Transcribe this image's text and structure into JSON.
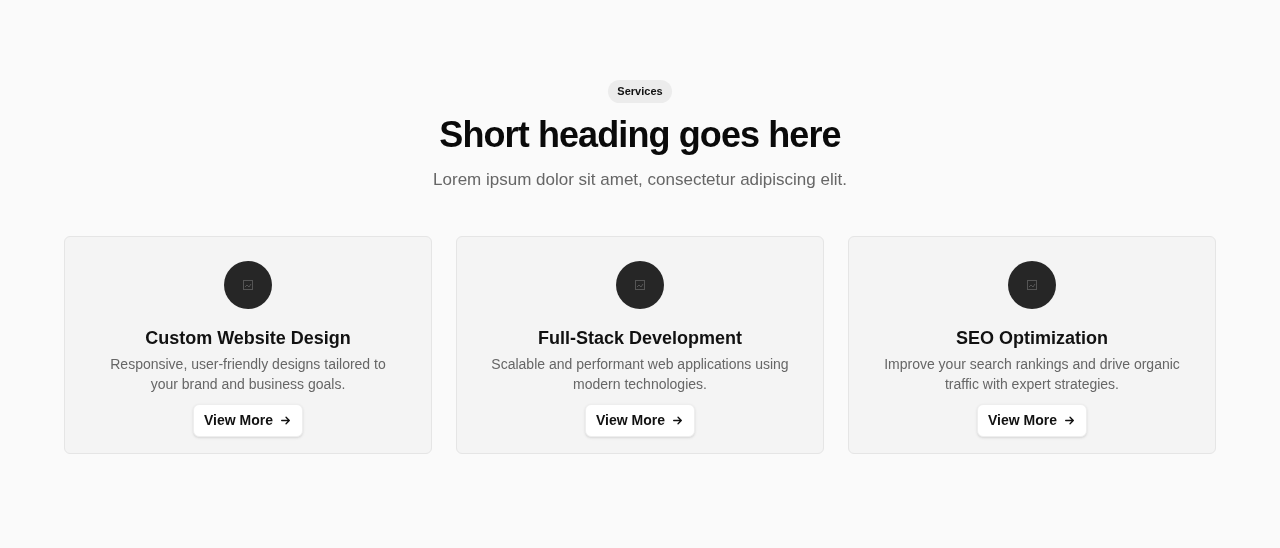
{
  "badge": "Services",
  "heading": "Short heading goes here",
  "subheading": "Lorem ipsum dolor sit amet, consectetur adipiscing elit.",
  "cards": [
    {
      "title": "Custom Website Design",
      "description": "Responsive, user-friendly designs tailored to your brand and business goals.",
      "button": "View More"
    },
    {
      "title": "Full-Stack Development",
      "description": "Scalable and performant web applications using modern technologies.",
      "button": "View More"
    },
    {
      "title": "SEO Optimization",
      "description": "Improve your search rankings and drive organic traffic with expert strategies.",
      "button": "View More"
    }
  ]
}
